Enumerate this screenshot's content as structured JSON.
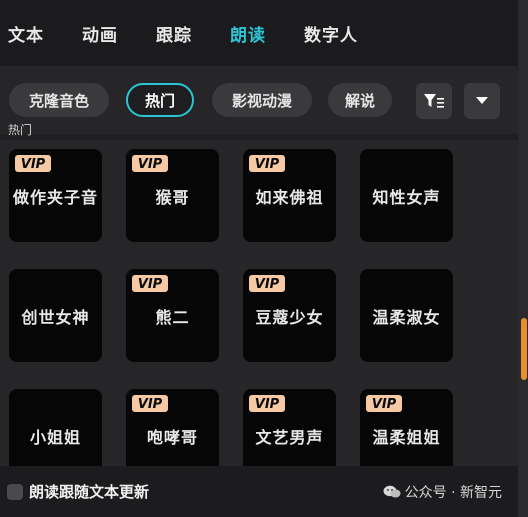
{
  "tabs": [
    {
      "label": "文本",
      "active": false
    },
    {
      "label": "动画",
      "active": false
    },
    {
      "label": "跟踪",
      "active": false
    },
    {
      "label": "朗读",
      "active": true
    },
    {
      "label": "数字人",
      "active": false
    }
  ],
  "filters": {
    "chips": [
      "克隆音色",
      "热门",
      "影视动漫",
      "解说"
    ],
    "active_chip": "热门",
    "filter_icon": "filter-sort-icon",
    "dropdown_icon": "caret-down-icon"
  },
  "section": {
    "label": "热门"
  },
  "voices": [
    {
      "name": "做作夹子音",
      "vip": true
    },
    {
      "name": "猴哥",
      "vip": true
    },
    {
      "name": "如来佛祖",
      "vip": true
    },
    {
      "name": "知性女声",
      "vip": false
    },
    {
      "name": "创世女神",
      "vip": false
    },
    {
      "name": "熊二",
      "vip": true
    },
    {
      "name": "豆蔻少女",
      "vip": true
    },
    {
      "name": "温柔淑女",
      "vip": false
    },
    {
      "name": "小姐姐",
      "vip": false
    },
    {
      "name": "咆哮哥",
      "vip": true
    },
    {
      "name": "文艺男声",
      "vip": true
    },
    {
      "name": "温柔姐姐",
      "vip": true
    }
  ],
  "vip_badge": {
    "text": "VIP",
    "color": "#f4c9a4"
  },
  "bottom": {
    "follow_label": "朗读跟随文本更新",
    "watermark": "公众号 · 新智元"
  },
  "colors": {
    "accent": "#2fc4d4",
    "scroll_thumb": "#e88e2c"
  }
}
